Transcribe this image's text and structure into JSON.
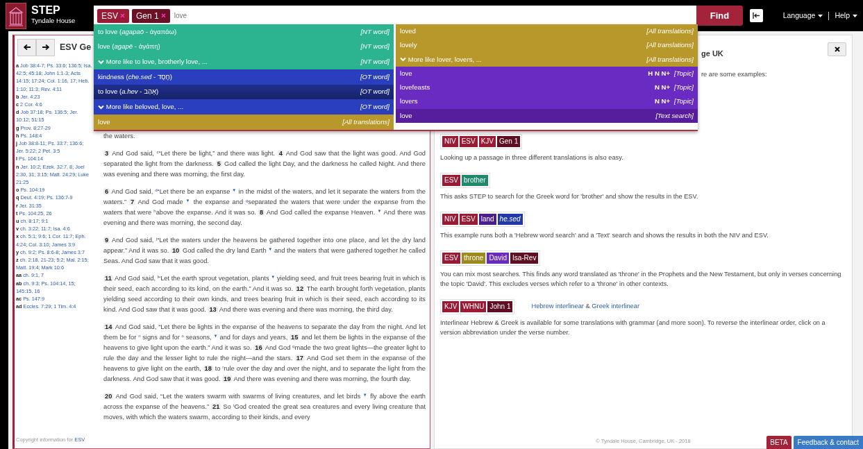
{
  "header": {
    "brand": {
      "title": "STEP",
      "subtitle": "Tyndale House"
    },
    "search": {
      "tags": [
        {
          "text": "ESV",
          "color": "#9b1b35"
        },
        {
          "text": "Gen 1",
          "color": "#6b1025"
        }
      ],
      "query": "love"
    },
    "find_button": "Find",
    "menus": [
      {
        "label": "Language"
      },
      {
        "label": "Help"
      }
    ]
  },
  "suggestions": {
    "columns": [
      [
        {
          "label": "to love (*agapaō* - ἀγαπάω)",
          "category": "[NT word]",
          "kind": "nt",
          "expander": false,
          "selected": false
        },
        {
          "label": "love (*agapē* - ἀγάπη)",
          "category": "[NT word]",
          "kind": "nt",
          "expander": false,
          "selected": false
        },
        {
          "label": "More like to love, brotherly love, ...",
          "category": "[NT word]",
          "kind": "nt",
          "expander": true,
          "selected": false
        },
        {
          "label": "kindness (*che.sed* - חֶסֶד)",
          "category": "[OT word]",
          "kind": "ot",
          "expander": false,
          "selected": false
        },
        {
          "label": "to love (*a.hev* - אָהַב)",
          "category": "[OT word]",
          "kind": "ot",
          "expander": false,
          "selected": true
        },
        {
          "label": "More like beloved, love, ...",
          "category": "[OT word]",
          "kind": "ot",
          "expander": true,
          "selected": false
        },
        {
          "label": "love",
          "category": "[All translations]",
          "kind": "all",
          "expander": false,
          "selected": false
        }
      ],
      [
        {
          "label": "loved",
          "category": "[All translations]",
          "kind": "all",
          "expander": false,
          "selected": false
        },
        {
          "label": "lovely",
          "category": "[All translations]",
          "kind": "all",
          "expander": false,
          "selected": false
        },
        {
          "label": "More like lover, lovers, ...",
          "category": "[All translations]",
          "kind": "all",
          "expander": true,
          "selected": false
        },
        {
          "label": "love",
          "sources": "H N N+",
          "category": "[Topic]",
          "kind": "topic",
          "expander": false,
          "selected": false
        },
        {
          "label": "lovefeasts",
          "sources": "N N+",
          "category": "[Topic]",
          "kind": "topic",
          "expander": false,
          "selected": false
        },
        {
          "label": "lovers",
          "sources": "N N+",
          "category": "[Topic]",
          "kind": "topic",
          "expander": false,
          "selected": false
        },
        {
          "label": "love",
          "category": "[Text search]",
          "kind": "text",
          "expander": false,
          "selected": false
        }
      ]
    ]
  },
  "passage": {
    "title": "ESV Ge",
    "footnotes": [
      {
        "letter": "a",
        "refs": "Job 38:4-7; Ps. 33:6; 136:5; Isa. 42:5; 45:18; John 1:1-3; Acts 14:15; 17:24; Col. 1:16, 17; Heb. 1:10; 11:3; Rev. 4:11"
      },
      {
        "letter": "b",
        "refs": "Jer. 4:23"
      },
      {
        "letter": "c",
        "refs": "2 Cor. 4:6"
      },
      {
        "letter": "d",
        "refs": "Job 37:18; Ps. 136:5; Jer. 10:12; 51:15"
      },
      {
        "letter": "g",
        "refs": "Prov. 8:27-29"
      },
      {
        "letter": "h",
        "refs": "Ps. 148:4"
      },
      {
        "letter": "j",
        "refs": "Job 38:8-11; Ps. 33:7; 136:6; Jer. 5:22; 2 Pet. 3:5"
      },
      {
        "letter": "l",
        "refs": "Ps. 104:14"
      },
      {
        "letter": "n",
        "refs": "Jer. 10:2; Ezek. 32:7, 8; Joel 2:30, 31; 3:15; Matt. 24:29; Luke 21:25"
      },
      {
        "letter": "o",
        "refs": "Ps. 104:19"
      },
      {
        "letter": "q",
        "refs": "Deut. 4:19; Ps. 136:7-9"
      },
      {
        "letter": "r",
        "refs": "Jer. 31:35"
      },
      {
        "letter": "t",
        "refs": "Ps. 104:25, 26"
      },
      {
        "letter": "u",
        "refs": "ch. 8:17; 9:1"
      },
      {
        "letter": "v",
        "refs": "ch. 3:22; 11:7; Isa. 4:6"
      },
      {
        "letter": "x",
        "refs": "ch. 5:1; 9:6; 1 Cor. 11:7; Eph. 4:24; Col. 3:10; James 3:9"
      },
      {
        "letter": "y",
        "refs": "ch. 9:2; Ps. 8:6-8; James 3:7"
      },
      {
        "letter": "z",
        "refs": "ch. 2:18, 21-23; 5:2; Mal. 2:15; Matt. 19:4; Mark 10:6"
      },
      {
        "letter": "aa",
        "refs": "ch. 9:1, 7"
      },
      {
        "letter": "ab",
        "refs": "ch. 9:3; Ps. 104:14, 15; 145:15, 16"
      },
      {
        "letter": "ac",
        "refs": "Ps. 147:9"
      },
      {
        "letter": "ad",
        "refs": "Eccles. 7:29; 1 Tim. 4:4"
      }
    ],
    "paragraphs": [
      "the waters.",
      "**3** And God said, $^{c}$“Let there be light,” and there was light. **4** And God saw that the light was good. And God separated the light from the darkness. **5** God called the light Day, and the darkness he called Night. And there was evening and there was morning, the first day.",
      "**6** And God said, $^{d}$“Let there be an expanse $^{▼}$ in the midst of the waters, and let it separate the waters from the waters.” **7** And God made $^{▼}$ the expanse and $^{g}$separated the waters that were under the expanse from the waters that were $^{h}$above the expanse. And it was so. **8** And God called the expanse Heaven. $^{▼}$ And there was evening and there was morning, the second day.",
      "**9** And God said, $^{j}$“Let the waters under the heavens be gathered together into one place, and let the dry land appear.” And it was so. **10** God called the dry land Earth $^{▼}$ and the waters that were gathered together he called Seas. And God saw that it was good.",
      "**11** And God said, $^{l}$“Let the earth sprout vegetation, plants $^{▼}$ yielding seed, and fruit trees bearing fruit in which is their seed, each according to its kind, on the earth.” And it was so. **12** The earth brought forth vegetation, plants yielding seed according to their own kinds, and trees bearing fruit in which is their seed, each according to its kind. And God saw that it was good. **13** And there was evening and there was morning, the third day.",
      "**14** And God said, “Let there be lights in the expanse of the heavens to separate the day from the night. And let them be for $^{n}$ signs and for $^{o}$ seasons, $^{▼}$ and for days and years, **15** and let them be lights in the expanse of the heavens to give light upon the earth.” And it was so. **16** And God $^{q}$made the two great lights—the greater light to rule the day and the lesser light to rule the night—and the stars. **17** And God set them in the expanse of the heavens to give light on the earth, **18** to $^{r}$rule over the day and over the night, and to separate the light from the darkness. And God saw that it was good. **19** And there was evening and there was morning, the fourth day.",
      "**20** And God said, “Let the waters swarm with swarms of living creatures, and let birds $^{▼}$ fly above the earth across the expanse of the heavens.” **21** So $^{t}$God created the great sea creatures and every living creature that moves, with which the waters swarm, according to their kinds, and every"
    ],
    "copyright": {
      "text": "Copyright information for",
      "link": "ESV"
    }
  },
  "help": {
    "heading": "ge UK",
    "intro": "re are some examples:",
    "examples": [
      {
        "tags": [
          {
            "text": "NIV",
            "kind": "version",
            "color": "#9b1b35"
          },
          {
            "text": "ESV",
            "kind": "version",
            "color": "#9b1b35"
          },
          {
            "text": "KJV",
            "kind": "version",
            "color": "#9b1b35"
          },
          {
            "text": "Gen 1",
            "kind": "reference",
            "color": "#5e0f22"
          }
        ],
        "description": "Looking up a passage in three different translations is also easy."
      },
      {
        "tags": [
          {
            "text": "ESV",
            "kind": "version",
            "color": "#9b1b35"
          },
          {
            "text": "brother",
            "kind": "greek",
            "color": "#1f8a6a"
          }
        ],
        "description": "This asks STEP to search for the Greek word for 'brother' and show the results in the ESV."
      },
      {
        "tags": [
          {
            "text": "NIV",
            "kind": "version",
            "color": "#9b1b35"
          },
          {
            "text": "ESV",
            "kind": "version",
            "color": "#9b1b35"
          },
          {
            "text": "land",
            "kind": "text",
            "color": "#4a1f8c"
          },
          {
            "text": "he.sed",
            "kind": "hebrew",
            "color": "#2038a8"
          }
        ],
        "description": "This example runs both a 'Hebrew word search' and a 'Text' search and shows the results in both the NIV and ESV."
      },
      {
        "tags": [
          {
            "text": "ESV",
            "kind": "version",
            "color": "#9b1b35"
          },
          {
            "text": "throne",
            "kind": "meaning",
            "color": "#9c8a1c"
          },
          {
            "text": "David",
            "kind": "topic",
            "color": "#6a2bc2"
          },
          {
            "text": "Isa-Rev",
            "kind": "reference",
            "color": "#5e0f22"
          }
        ],
        "description": "You can mix most searches. This finds any word translated as 'throne' in the Prophets and the New Testament, but only in verses concerning the topic 'David'. This excludes verses which refer to a 'throne' in other contexts."
      },
      {
        "tags": [
          {
            "text": "KJV",
            "kind": "version",
            "color": "#9b1b35"
          },
          {
            "text": "WHNU",
            "kind": "version",
            "color": "#9b1b35"
          },
          {
            "text": "John 1",
            "kind": "reference",
            "color": "#5e0f22"
          }
        ],
        "links": [
          "Hebrew interlinear",
          "Greek interlinear"
        ],
        "link_separator": "&",
        "description": "Interlinear Hebrew & Greek is available for some translations with grammar (and more soon). To reverse the interlinear order, click on a version abbreviation under the verse number."
      }
    ]
  },
  "footer": {
    "credit": "© Tyndale House, Cambridge, UK - 2018",
    "beta": "BETA",
    "feedback": "Feedback & contact"
  }
}
